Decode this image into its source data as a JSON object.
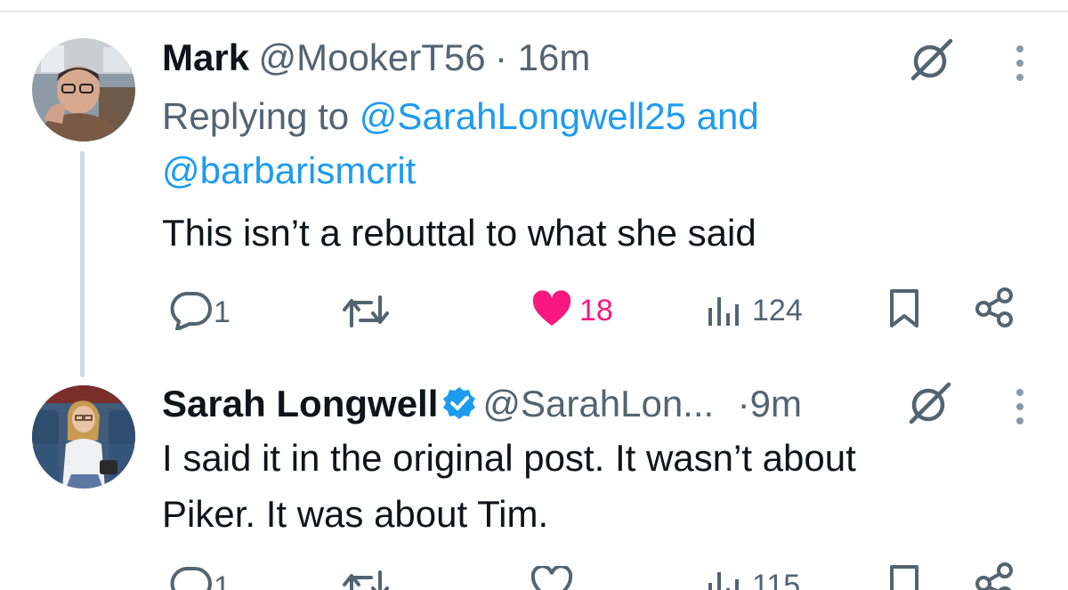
{
  "colors": {
    "accent": "#1d9bf0",
    "like": "#f91880",
    "muted": "#536471",
    "text": "#0f1419"
  },
  "tweets": [
    {
      "name": "Mark",
      "handle": "@MookerT56",
      "time": "· 16m",
      "replying_prefix": "Replying to ",
      "replying_mention_1": "@SarahLongwell25",
      "replying_and": " and",
      "replying_mention_2": "@barbarismcrit",
      "text": "This isn’t a rebuttal to what she said",
      "actions": {
        "replies": "1",
        "retweets": "",
        "likes": "18",
        "views": "124"
      },
      "liked": true
    },
    {
      "name": "Sarah Longwell",
      "handle": "@SarahLon...",
      "time": "·9m",
      "verified": true,
      "text_line_1": "I said it in the original post. It wasn’t about",
      "text_line_2": "Piker. It was about Tim.",
      "actions": {
        "replies": "1",
        "retweets": "",
        "likes": "",
        "views": "115"
      },
      "liked": false
    }
  ],
  "icons": [
    "grok-icon",
    "more-icon",
    "reply-icon",
    "retweet-icon",
    "heart-icon",
    "views-icon",
    "bookmark-icon",
    "share-icon",
    "verified-badge-icon"
  ]
}
